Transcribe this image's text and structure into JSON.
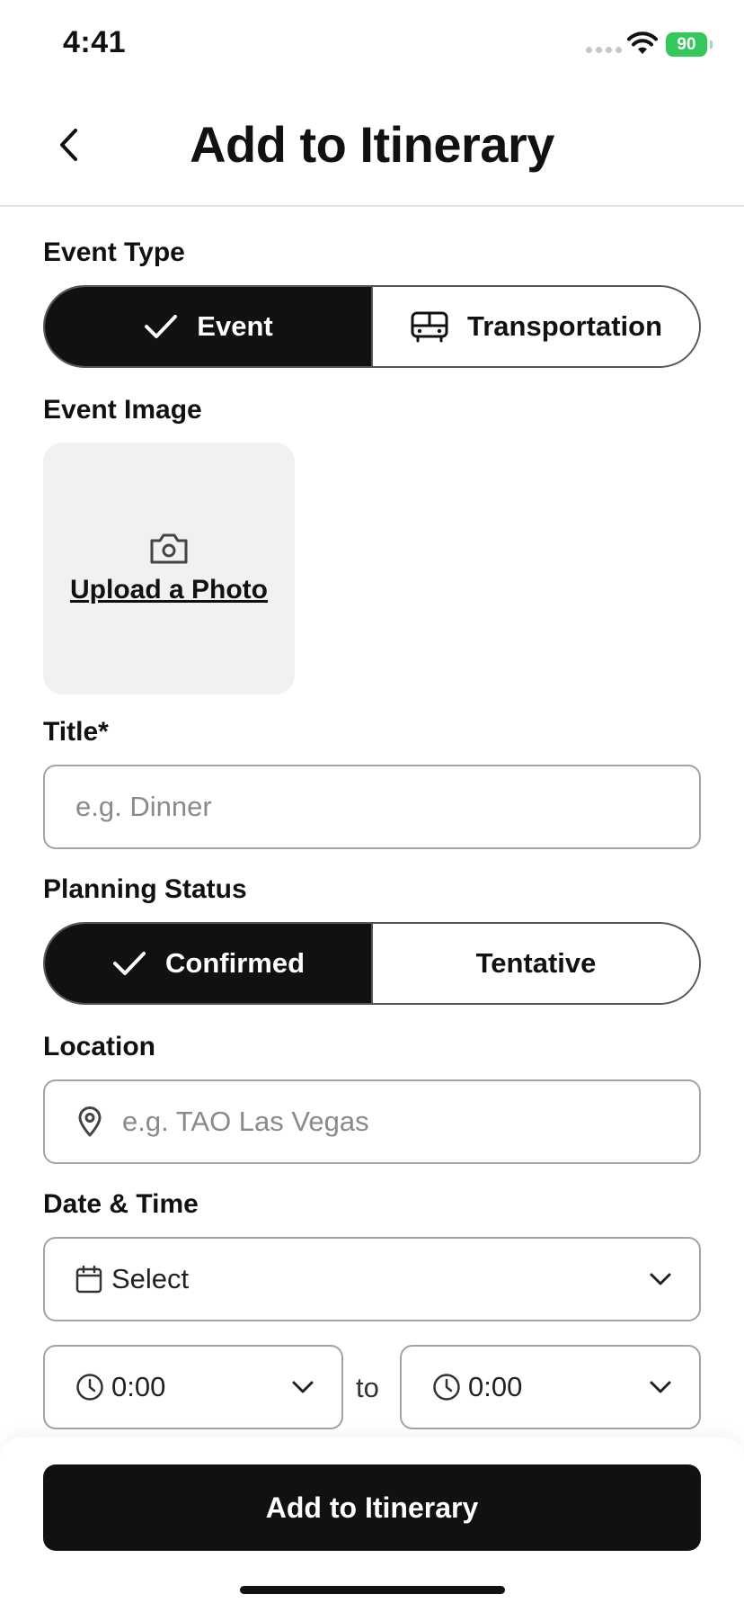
{
  "status_bar": {
    "time": "4:41",
    "battery": "90"
  },
  "header": {
    "title": "Add to Itinerary",
    "back_icon": "chevron-left-icon"
  },
  "event_type": {
    "label": "Event Type",
    "options": [
      {
        "label": "Event",
        "icon": "check-icon",
        "selected": true
      },
      {
        "label": "Transportation",
        "icon": "bus-icon",
        "selected": false
      }
    ]
  },
  "event_image": {
    "label": "Event Image",
    "upload_label": "Upload a Photo",
    "icon": "camera-icon"
  },
  "title_field": {
    "label": "Title*",
    "placeholder": "e.g. Dinner"
  },
  "planning_status": {
    "label": "Planning Status",
    "options": [
      {
        "label": "Confirmed",
        "icon": "check-icon",
        "selected": true
      },
      {
        "label": "Tentative",
        "selected": false
      }
    ]
  },
  "location": {
    "label": "Location",
    "placeholder": "e.g. TAO Las Vegas",
    "icon": "map-pin-icon"
  },
  "date_time": {
    "label": "Date & Time",
    "date_value": "Select",
    "start_time": "0:00",
    "separator": "to",
    "end_time": "0:00"
  },
  "footer": {
    "submit_label": "Add to Itinerary"
  },
  "colors": {
    "primary": "#111111",
    "battery": "#34c759",
    "surface": "#f1f1f3",
    "border": "#a3a3a3"
  }
}
